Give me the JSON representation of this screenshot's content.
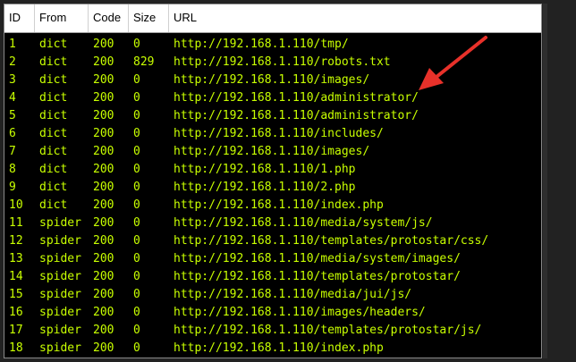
{
  "columns": {
    "id": "ID",
    "from": "From",
    "code": "Code",
    "size": "Size",
    "url": "URL"
  },
  "rows": [
    {
      "id": "1",
      "from": "dict",
      "code": "200",
      "size": "0",
      "url": "http://192.168.1.110/tmp/"
    },
    {
      "id": "2",
      "from": "dict",
      "code": "200",
      "size": "829",
      "url": "http://192.168.1.110/robots.txt"
    },
    {
      "id": "3",
      "from": "dict",
      "code": "200",
      "size": "0",
      "url": "http://192.168.1.110/images/"
    },
    {
      "id": "4",
      "from": "dict",
      "code": "200",
      "size": "0",
      "url": "http://192.168.1.110/administrator/"
    },
    {
      "id": "5",
      "from": "dict",
      "code": "200",
      "size": "0",
      "url": "http://192.168.1.110/administrator/"
    },
    {
      "id": "6",
      "from": "dict",
      "code": "200",
      "size": "0",
      "url": "http://192.168.1.110/includes/"
    },
    {
      "id": "7",
      "from": "dict",
      "code": "200",
      "size": "0",
      "url": "http://192.168.1.110/images/"
    },
    {
      "id": "8",
      "from": "dict",
      "code": "200",
      "size": "0",
      "url": "http://192.168.1.110/1.php"
    },
    {
      "id": "9",
      "from": "dict",
      "code": "200",
      "size": "0",
      "url": "http://192.168.1.110/2.php"
    },
    {
      "id": "10",
      "from": "dict",
      "code": "200",
      "size": "0",
      "url": "http://192.168.1.110/index.php"
    },
    {
      "id": "11",
      "from": "spider",
      "code": "200",
      "size": "0",
      "url": "http://192.168.1.110/media/system/js/"
    },
    {
      "id": "12",
      "from": "spider",
      "code": "200",
      "size": "0",
      "url": "http://192.168.1.110/templates/protostar/css/"
    },
    {
      "id": "13",
      "from": "spider",
      "code": "200",
      "size": "0",
      "url": "http://192.168.1.110/media/system/images/"
    },
    {
      "id": "14",
      "from": "spider",
      "code": "200",
      "size": "0",
      "url": "http://192.168.1.110/templates/protostar/"
    },
    {
      "id": "15",
      "from": "spider",
      "code": "200",
      "size": "0",
      "url": "http://192.168.1.110/media/jui/js/"
    },
    {
      "id": "16",
      "from": "spider",
      "code": "200",
      "size": "0",
      "url": "http://192.168.1.110/images/headers/"
    },
    {
      "id": "17",
      "from": "spider",
      "code": "200",
      "size": "0",
      "url": "http://192.168.1.110/templates/protostar/js/"
    },
    {
      "id": "18",
      "from": "spider",
      "code": "200",
      "size": "0",
      "url": "http://192.168.1.110/index.php"
    }
  ],
  "colors": {
    "row_text": "#c8ff00",
    "table_bg": "#000000",
    "arrow": "#e8312a"
  },
  "annotation": {
    "icon": "red-arrow-icon"
  }
}
